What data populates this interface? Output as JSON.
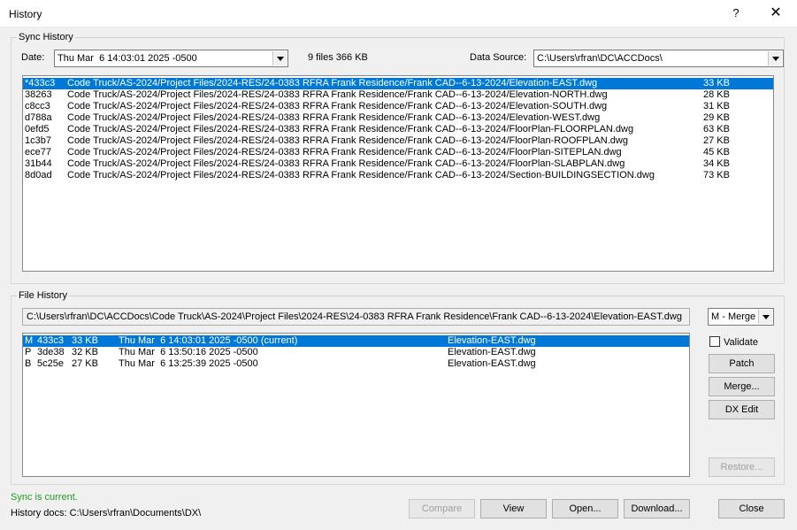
{
  "window": {
    "title": "History",
    "help_label": "?",
    "close_glyph": "✕"
  },
  "sync_history": {
    "group_label": "Sync History",
    "date_label": "Date:",
    "date_value": "Thu Mar  6 14:03:01 2025 -0500",
    "summary": "9 files 366 KB",
    "data_source_label": "Data Source:",
    "data_source_value": "C:\\Users\\rfran\\DC\\ACCDocs\\",
    "files": [
      {
        "id": "*433c3",
        "path": "Code Truck/AS-2024/Project Files/2024-RES/24-0383 RFRA Frank Residence/Frank CAD--6-13-2024/Elevation-EAST.dwg",
        "size": "33 KB"
      },
      {
        "id": "38263",
        "path": "Code Truck/AS-2024/Project Files/2024-RES/24-0383 RFRA Frank Residence/Frank CAD--6-13-2024/Elevation-NORTH.dwg",
        "size": "28 KB"
      },
      {
        "id": "c8cc3",
        "path": "Code Truck/AS-2024/Project Files/2024-RES/24-0383 RFRA Frank Residence/Frank CAD--6-13-2024/Elevation-SOUTH.dwg",
        "size": "31 KB"
      },
      {
        "id": "d788a",
        "path": "Code Truck/AS-2024/Project Files/2024-RES/24-0383 RFRA Frank Residence/Frank CAD--6-13-2024/Elevation-WEST.dwg",
        "size": "29 KB"
      },
      {
        "id": "0efd5",
        "path": "Code Truck/AS-2024/Project Files/2024-RES/24-0383 RFRA Frank Residence/Frank CAD--6-13-2024/FloorPlan-FLOORPLAN.dwg",
        "size": "63 KB"
      },
      {
        "id": "1c3b7",
        "path": "Code Truck/AS-2024/Project Files/2024-RES/24-0383 RFRA Frank Residence/Frank CAD--6-13-2024/FloorPlan-ROOFPLAN.dwg",
        "size": "27 KB"
      },
      {
        "id": "ece77",
        "path": "Code Truck/AS-2024/Project Files/2024-RES/24-0383 RFRA Frank Residence/Frank CAD--6-13-2024/FloorPlan-SITEPLAN.dwg",
        "size": "45 KB"
      },
      {
        "id": "31b44",
        "path": "Code Truck/AS-2024/Project Files/2024-RES/24-0383 RFRA Frank Residence/Frank CAD--6-13-2024/FloorPlan-SLABPLAN.dwg",
        "size": "34 KB"
      },
      {
        "id": "8d0ad",
        "path": "Code Truck/AS-2024/Project Files/2024-RES/24-0383 RFRA Frank Residence/Frank CAD--6-13-2024/Section-BUILDINGSECTION.dwg",
        "size": "73 KB"
      }
    ]
  },
  "file_history": {
    "group_label": "File History",
    "path": "C:\\Users\\rfran\\DC\\ACCDocs\\Code Truck\\AS-2024\\Project Files\\2024-RES\\24-0383 RFRA Frank Residence\\Frank CAD--6-13-2024\\Elevation-EAST.dwg",
    "mode_value": "M - Merge",
    "validate_label": "Validate",
    "versions": [
      {
        "type": "M",
        "id": "433c3",
        "size": "33 KB",
        "date": "Thu Mar  6 14:03:01 2025 -0500 (current)",
        "name": "Elevation-EAST.dwg"
      },
      {
        "type": "P",
        "id": "3de38",
        "size": "32 KB",
        "date": "Thu Mar  6 13:50:16 2025 -0500",
        "name": "Elevation-EAST.dwg"
      },
      {
        "type": "B",
        "id": "5c25e",
        "size": "27 KB",
        "date": "Thu Mar  6 13:25:39 2025 -0500",
        "name": "Elevation-EAST.dwg"
      }
    ],
    "buttons": {
      "patch": "Patch",
      "merge": "Merge...",
      "dx_edit": "DX Edit",
      "restore": "Restore..."
    }
  },
  "footer": {
    "status": "Sync is current.",
    "history_docs": "History docs: C:\\Users\\rfran\\Documents\\DX\\",
    "buttons": {
      "compare": "Compare",
      "view": "View",
      "open": "Open...",
      "download": "Download...",
      "close": "Close"
    }
  },
  "colors": {
    "selection": "#0078d7",
    "status_ok": "#20a020"
  },
  "icons": {
    "dropdown": "chevron-down-icon",
    "help": "help-icon",
    "close": "close-icon"
  }
}
